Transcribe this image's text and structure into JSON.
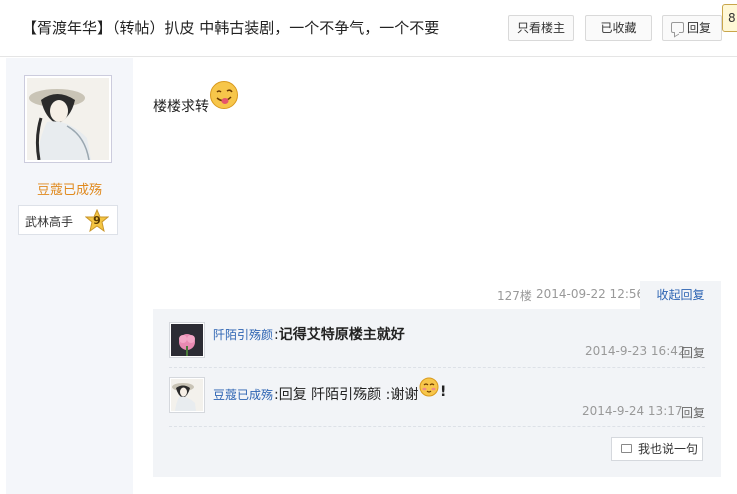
{
  "header": {
    "title": "【胥渡年华】（转帖）扒皮 中韩古装剧，一个不争气，一个不要",
    "only_op_label": "只看楼主",
    "favorited_label": "已收藏",
    "reply_label": "回复",
    "floor_tip": "8"
  },
  "author": {
    "name": "豆蔻已成殇",
    "rank_title": "武林高手",
    "rank_level": "9"
  },
  "post": {
    "text": "楼楼求转",
    "floor": "127楼",
    "time": "2014-09-22 12:56",
    "collapse_label": "收起回复"
  },
  "comments": [
    {
      "user": "阡陌引殇颜",
      "separator": ":",
      "text": "记得艾特原楼主就好",
      "time": "2014-9-23 16:42",
      "reply_label": "回复"
    },
    {
      "user": "豆蔻已成殇",
      "separator": ":",
      "text_prefix": "回复 阡陌引殇颜 :谢谢",
      "text_suffix": "!",
      "time": "2014-9-24 13:17",
      "reply_label": "回复"
    }
  ],
  "say_button_label": "我也说一句",
  "colors": {
    "author_name": "#e08a1e",
    "link_blue": "#2d64b3",
    "panel_bg": "#f4f6fa"
  }
}
